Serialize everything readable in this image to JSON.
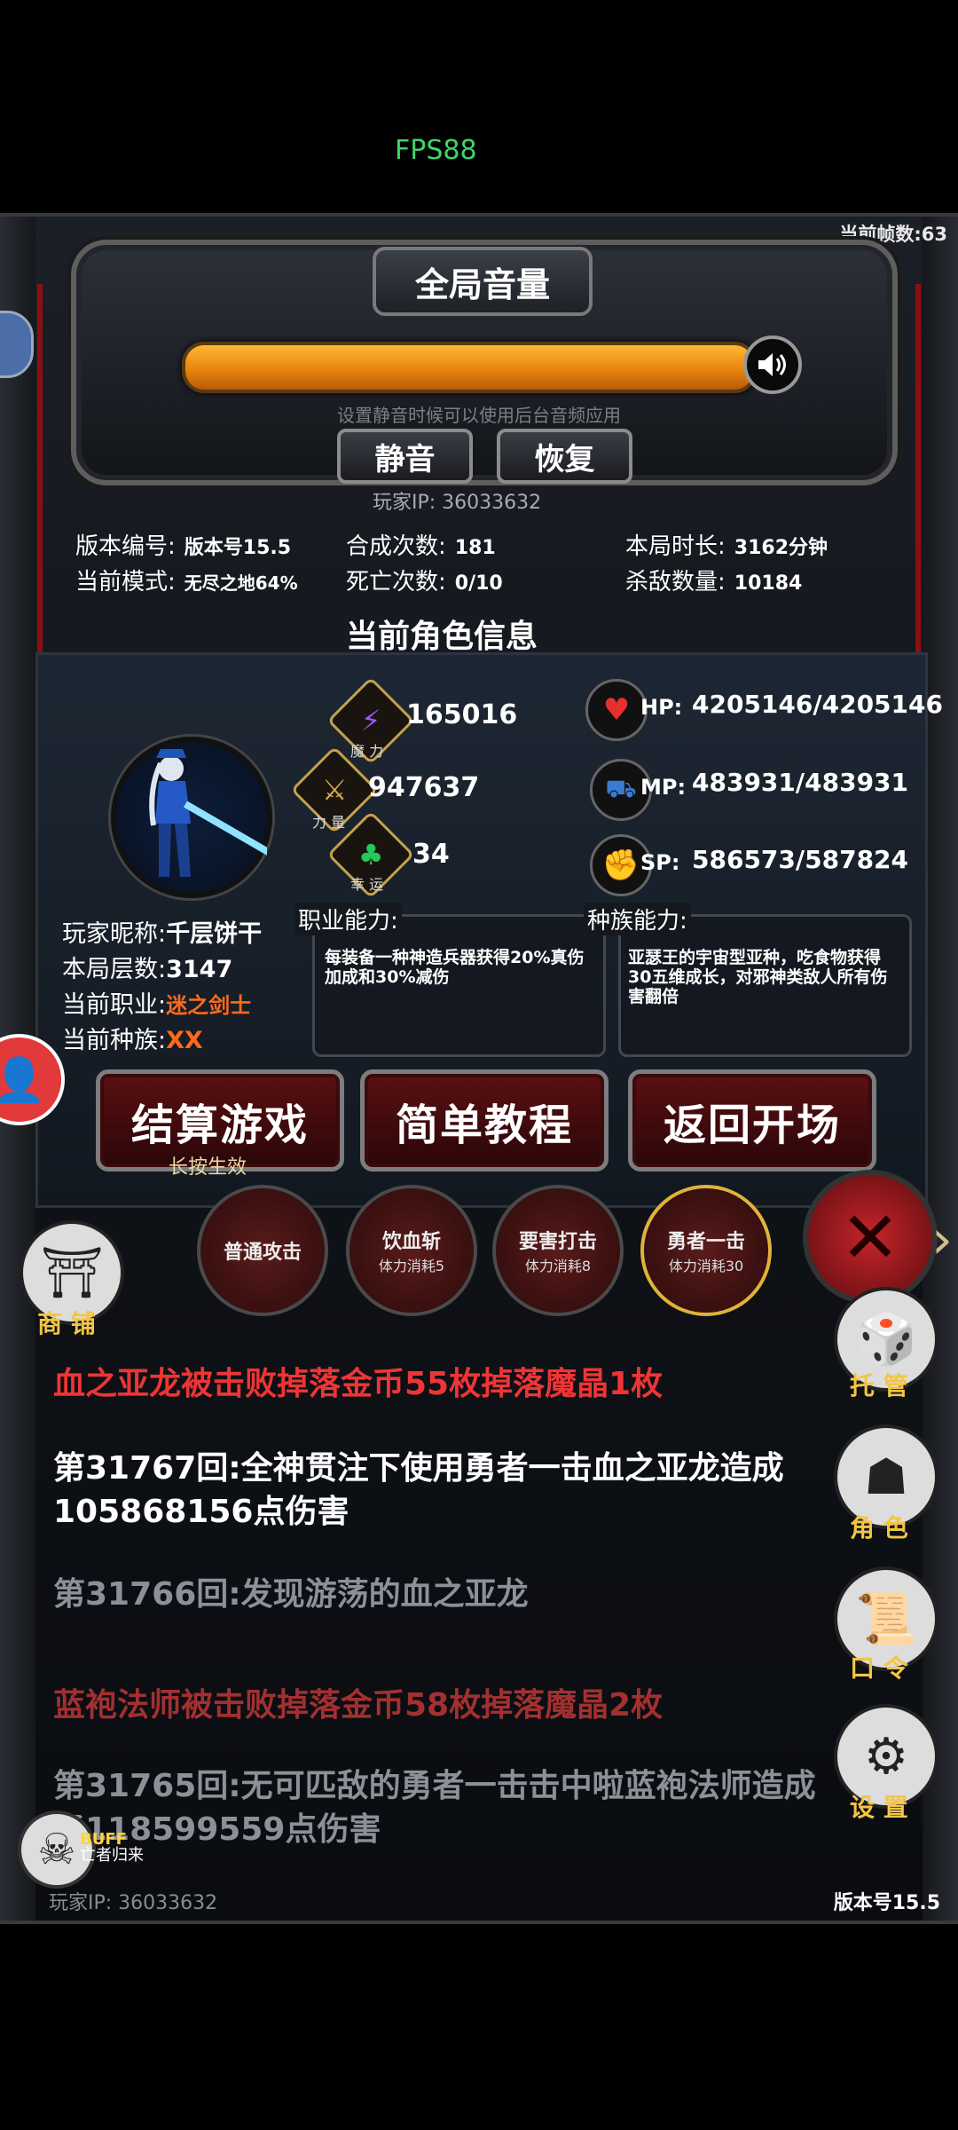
{
  "fps": "FPS88",
  "current_frame_label": "当前帧数:63",
  "volume": {
    "title": "全局音量",
    "level": 1.0,
    "hint": "设置静音时候可以使用后台音频应用",
    "mute_label": "静音",
    "restore_label": "恢复"
  },
  "player_ip_top": "玩家IP:  36033632",
  "stats": {
    "version_label": "版本编号:",
    "version_value": "版本号15.5",
    "mode_label": "当前模式:",
    "mode_value": "无尽之地64%",
    "craft_label": "合成次数:",
    "craft_value": "181",
    "death_label": "死亡次数:",
    "death_value": "0/10",
    "duration_label": "本局时长:",
    "duration_value": "3162分钟",
    "kills_label": "杀敌数量:",
    "kills_value": "10184"
  },
  "character_section_title": "当前角色信息",
  "attributes": {
    "magic_label": "魔 力",
    "magic_value": "165016",
    "strength_label": "力 量",
    "strength_value": "947637",
    "luck_label": "幸 运",
    "luck_value": "34"
  },
  "resources": {
    "hp_label": "HP:",
    "hp_value": "4205146/4205146",
    "mp_label": "MP:",
    "mp_value": "483931/483931",
    "sp_label": "SP:",
    "sp_value": "586573/587824"
  },
  "player_info": {
    "nickname_label": "玩家昵称:",
    "nickname_value": "千层饼干",
    "floors_label": "本局层数:",
    "floors_value": "3147",
    "job_label": "当前职业:",
    "job_value": "迷之剑士",
    "race_label": "当前种族:",
    "race_value": "XX"
  },
  "abilities": {
    "job_tag": "职业能力:",
    "job_text": "每装备一种神造兵器获得20%真伤加成和30%减伤",
    "race_tag": "种族能力:",
    "race_text": "亚瑟王的宇宙型亚种，吃食物获得30五维成长，对邪神类敌人所有伤害翻倍"
  },
  "buttons": {
    "settle": "结算游戏",
    "settle_sub": "长按生效",
    "tutorial": "简单教程",
    "back": "返回开场"
  },
  "skills": [
    {
      "name": "普通攻击",
      "cost": ""
    },
    {
      "name": "饮血斩",
      "cost": "体力消耗5"
    },
    {
      "name": "要害打击",
      "cost": "体力消耗8"
    },
    {
      "name": "勇者一击",
      "cost": "体力消耗30"
    }
  ],
  "side": {
    "shop": "商 铺",
    "auto": "托 管",
    "role": "角 色",
    "code": "口 令",
    "settings": "设 置"
  },
  "log": [
    "血之亚龙被击败掉落金币55枚掉落魔晶1枚",
    "第31767回:全神贯注下使用勇者一击血之亚龙造成105868156点伤害",
    "第31766回:发现游荡的血之亚龙",
    "蓝袍法师被击败掉落金币58枚掉落魔晶2枚",
    "第31765回:无可匹敌的勇者一击击中啦蓝袍法师造成了118599559点伤害"
  ],
  "buff": {
    "line1": "BUFF",
    "line2": "亡者归来"
  },
  "bottom_ip": "玩家IP:  36033632",
  "bottom_version": "版本号15.5",
  "colors": {
    "accent_red": "#ee3535",
    "volume_orange": "#e8850e",
    "job_orange": "#ff6a1a",
    "side_gold": "#f3c545"
  }
}
